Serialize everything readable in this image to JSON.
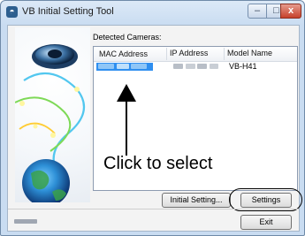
{
  "window": {
    "title": "VB Initial Setting Tool",
    "app_icon_glyph": "◓",
    "controls": {
      "minimize": "–",
      "maximize": "□",
      "close": "x"
    }
  },
  "main": {
    "group_label": "Detected Cameras:",
    "columns": [
      "MAC Address",
      "IP Address",
      "Model Name"
    ],
    "rows": [
      {
        "mac": "",
        "ip": "",
        "model": "VB-H41",
        "selected": true
      }
    ],
    "callout": "Click to select"
  },
  "buttons": {
    "initial_setting": "Initial Setting...",
    "settings": "Settings",
    "exit": "Exit"
  },
  "colors": {
    "selection": "#2f8ff0",
    "accent": "#2d5f8f"
  },
  "icons": {
    "app_icon": "camera-globe-icon",
    "arrow": "up-arrow-annotation"
  }
}
